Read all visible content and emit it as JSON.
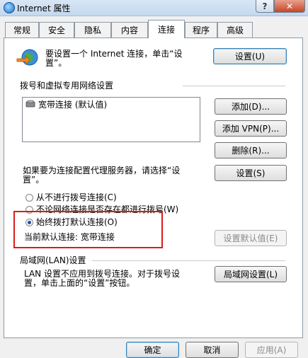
{
  "window": {
    "title": "Internet 属性",
    "help_label": "?",
    "close_label": "✕"
  },
  "tabs": [
    {
      "label": "常规"
    },
    {
      "label": "安全"
    },
    {
      "label": "隐私"
    },
    {
      "label": "内容"
    },
    {
      "label": "连接"
    },
    {
      "label": "程序"
    },
    {
      "label": "高级"
    }
  ],
  "active_tab": "连接",
  "setup": {
    "text_line1": "要设置一个 Internet 连接，单击“设",
    "text_line2": "置”。",
    "button_label": "设置(U)"
  },
  "dialup": {
    "section_title": "拨号和虚拟专用网络设置",
    "list_items": [
      "宽带连接 (默认值)"
    ],
    "add_label": "添加(D)...",
    "add_vpn_label": "添加 VPN(P)...",
    "remove_label": "删除(R)...",
    "proxy_text_line1": "如果要为连接配置代理服务器，请选择“设",
    "proxy_text_line2": "置”。",
    "settings_label": "设置(S)",
    "radio_never": "从不进行拨号连接(C)",
    "radio_whenever": "不论网络连接是否存在都进行拨号(W)",
    "radio_always": "始终拨打默认连接(O)",
    "current_default": "当前默认连接:  宽带连接",
    "set_default_label": "设置默认值(E)",
    "selected_radio": "always"
  },
  "lan": {
    "section_title": "局域网(LAN)设置",
    "text_line1": "LAN 设置不应用到拨号连接。对于拨号设",
    "text_line2": "置，单击上面的“设置”按钮。",
    "button_label": "局域网设置(L)"
  },
  "footer": {
    "ok_label": "确定",
    "cancel_label": "取消",
    "apply_label": "应用(A)"
  },
  "colors": {
    "highlight_border": "#d91c1c",
    "panel_bg": "#ffffff",
    "dialog_bg": "#f0f0f0"
  }
}
